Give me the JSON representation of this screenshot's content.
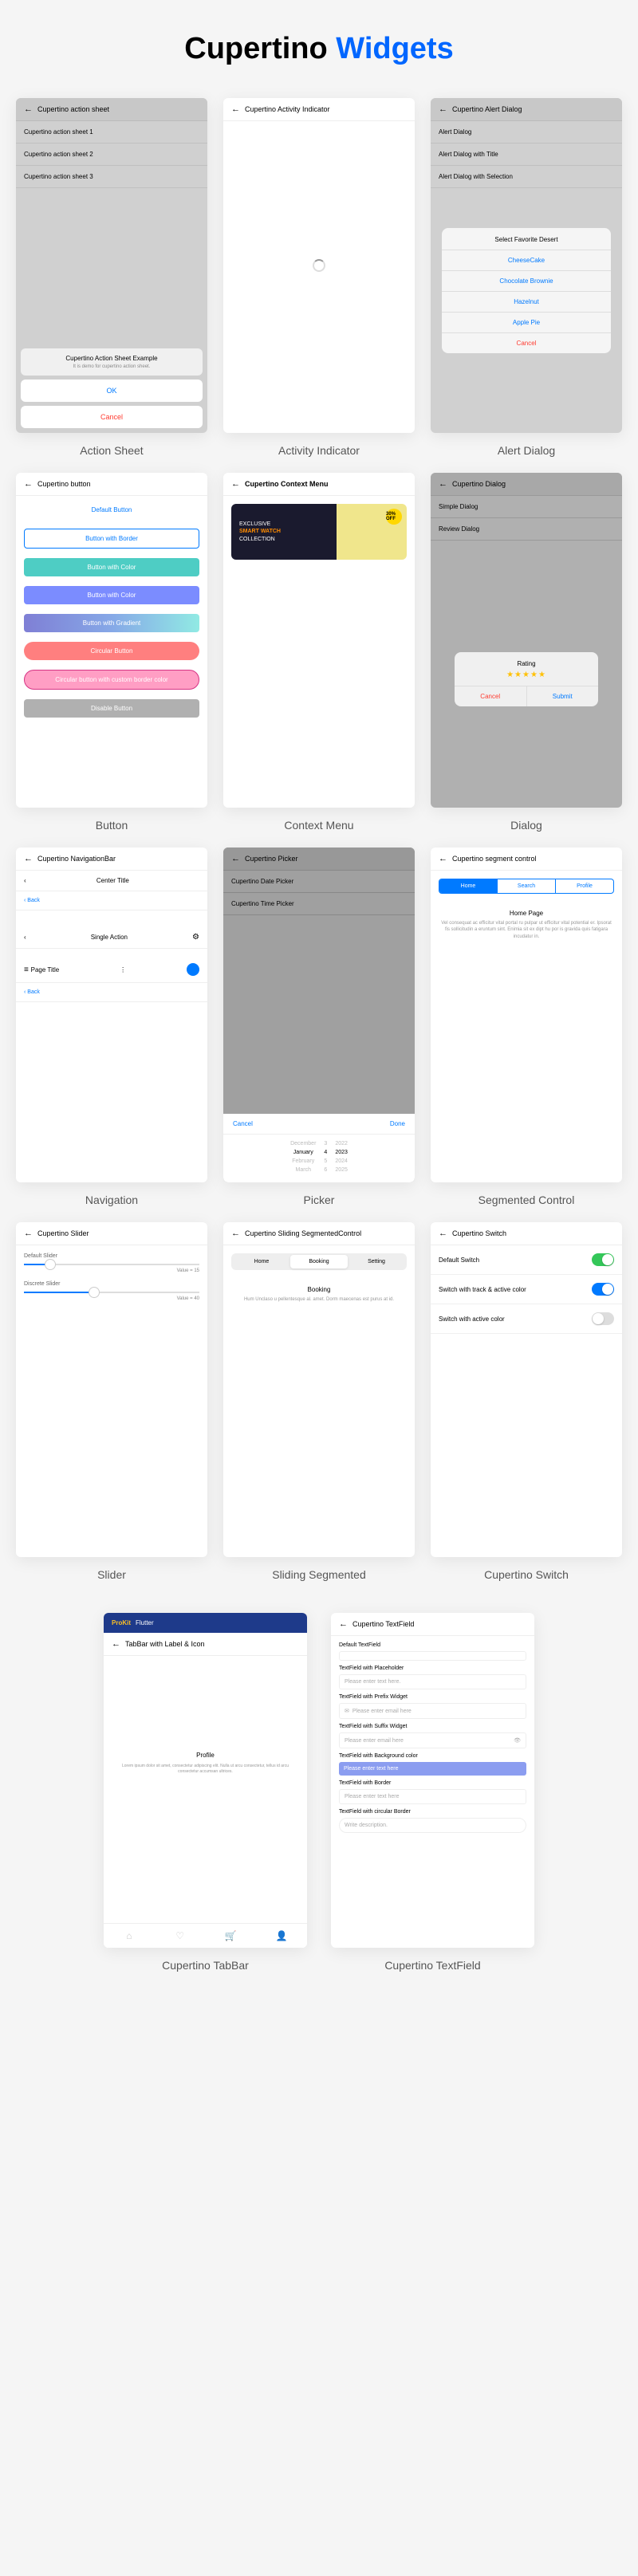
{
  "main_title_1": "Cupertino",
  "main_title_2": "Widgets",
  "labels": {
    "action_sheet": "Action Sheet",
    "activity": "Activity Indicator",
    "alert": "Alert Dialog",
    "button": "Button",
    "context": "Context Menu",
    "dialog": "Dialog",
    "navigation": "Navigation",
    "picker": "Picker",
    "segmented": "Segmented Control",
    "slider": "Slider",
    "sliding": "Sliding Segmented",
    "switch": "Cupertino Switch",
    "tabbar": "Cupertino TabBar",
    "textfield": "Cupertino TextField"
  },
  "action_sheet": {
    "title": "Cupertino action sheet",
    "items": [
      "Cupertino action sheet 1",
      "Cupertino action sheet 2",
      "Cupertino action sheet 3"
    ],
    "modal_title": "Cupertino Action Sheet Example",
    "modal_sub": "It is demo for cupertino action sheet.",
    "ok": "OK",
    "cancel": "Cancel"
  },
  "activity": {
    "title": "Cupertino Activity Indicator"
  },
  "alert": {
    "title": "Cupertino Alert Dialog",
    "items": [
      "Alert Dialog",
      "Alert Dialog with Title",
      "Alert Dialog with Selection"
    ],
    "modal_title": "Select Favorite Desert",
    "opts": [
      "CheeseCake",
      "Chocolate Brownie",
      "Hazelnut",
      "Apple Pie",
      "Cancel"
    ]
  },
  "button": {
    "title": "Cupertino button",
    "btns": [
      "Default Button",
      "Button with Border",
      "Button with Color",
      "Button with Gradient",
      "Circular Button",
      "Circular button with custom border color",
      "Disable Button"
    ]
  },
  "context": {
    "title": "Cupertino Context Menu",
    "banner_1": "EXCLUSIVE",
    "banner_2": "SMART WATCH",
    "banner_3": "COLLECTION",
    "badge": "30% OFF"
  },
  "dialog": {
    "title": "Cupertino Dialog",
    "items": [
      "Simple Dialog",
      "Review Dialog"
    ],
    "modal_title": "Rating",
    "cancel": "Cancel",
    "submit": "Submit"
  },
  "nav": {
    "title": "Cupertino NavigationBar",
    "back": "Back",
    "center": "Center Title",
    "single": "Single Action",
    "page": "Page Title"
  },
  "picker": {
    "title": "Cupertino Picker",
    "items": [
      "Cupertino Date Picker",
      "Cupertino Time Picker"
    ],
    "cancel": "Cancel",
    "done": "Done",
    "months": [
      "December",
      "January",
      "February",
      "March"
    ],
    "days": [
      "3",
      "4",
      "5",
      "6"
    ],
    "years": [
      "2022",
      "2023",
      "2024",
      "2025"
    ]
  },
  "segment": {
    "title": "Cupertino segment control",
    "tabs": [
      "Home",
      "Search",
      "Profile"
    ],
    "content_title": "Home Page",
    "content_desc": "Vel consequat ac efficitur vital portal ru pulpar ut efficitur vital potential er. Ipsorat fis sollicitudin a eruntum sint. Enimia sit ex dipt hu por is gravida quis fatigara incudatur in."
  },
  "slider": {
    "title": "Cupertino Slider",
    "default": "Default Slider",
    "discrete": "Discrete Slider",
    "val1": "Value = 15",
    "val2": "Value = 40"
  },
  "sliding": {
    "title": "Cupertino Sliding SegmentedControl",
    "tabs": [
      "Home",
      "Booking",
      "Setting"
    ],
    "content_title": "Booking",
    "content_desc": "Hum Unclaso u pellentesque al. amet. Dorm maecenas est purus at id."
  },
  "switch_d": {
    "title": "Cupertino Switch",
    "rows": [
      "Default Switch",
      "Switch with track & active color",
      "Switch with active color"
    ]
  },
  "tabbar_d": {
    "brand1": "ProKit",
    "brand2": "Flutter",
    "title": "TabBar with Label & Icon",
    "profile": "Profile",
    "desc": "Lorem ipsum dolor sit amet, consectetur adipiscing elit. Nulla ut arcu consectetur, tellus id arcu consectetur accumsan ultrices."
  },
  "textfield": {
    "title": "Cupertino TextField",
    "sections": [
      "Default TextField",
      "TextField with Placeholder",
      "TextField with Prefix Widget",
      "TextField with Suffix Widget",
      "TextField with Background color",
      "TextField with Border",
      "TextField with circular Border"
    ],
    "placeholders": [
      "Please enter text here.",
      "Please enter email here",
      "Please enter email here",
      "Please enter text here",
      "Please enter text here",
      "Write description."
    ]
  }
}
